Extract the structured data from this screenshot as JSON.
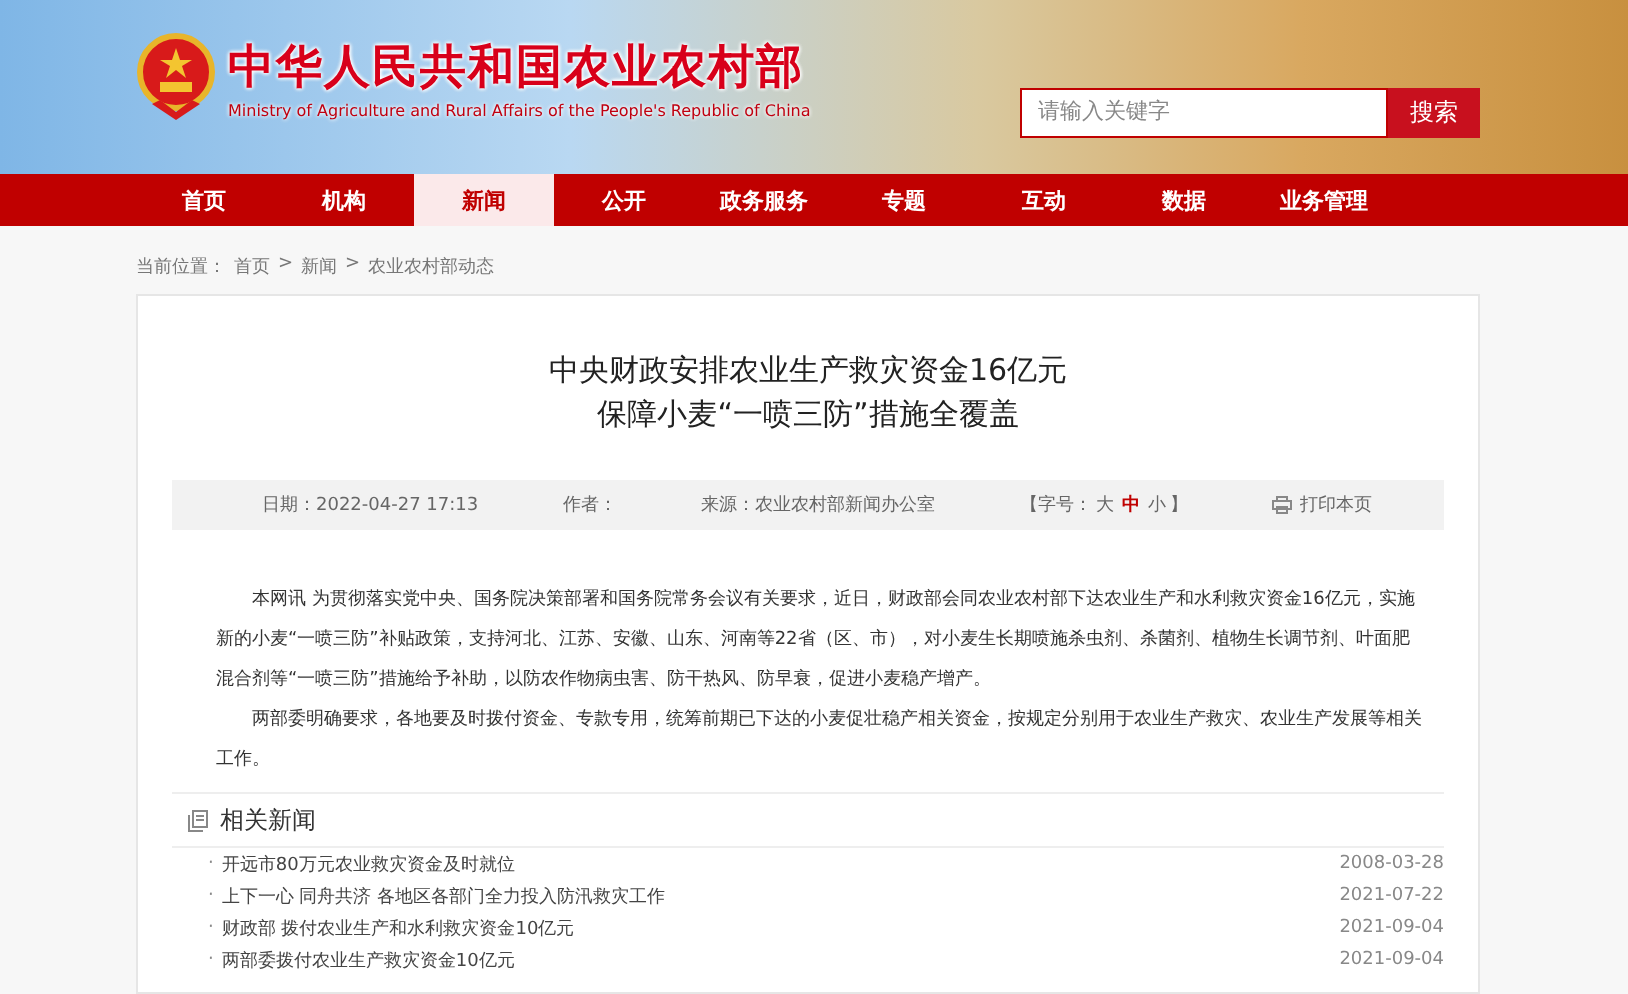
{
  "header": {
    "title": "中华人民共和国农业农村部",
    "subtitle": "Ministry of Agriculture and Rural Affairs of the People's Republic of China",
    "search": {
      "placeholder": "请输入关键字",
      "button": "搜索"
    }
  },
  "nav": [
    {
      "label": "首页",
      "selected": false
    },
    {
      "label": "机构",
      "selected": false
    },
    {
      "label": "新闻",
      "selected": true
    },
    {
      "label": "公开",
      "selected": false
    },
    {
      "label": "政务服务",
      "selected": false
    },
    {
      "label": "专题",
      "selected": false
    },
    {
      "label": "互动",
      "selected": false
    },
    {
      "label": "数据",
      "selected": false
    },
    {
      "label": "业务管理",
      "selected": false
    }
  ],
  "breadcrumb": {
    "label": "当前位置：",
    "items": [
      "首页",
      "新闻",
      "农业农村部动态"
    ],
    "separator": ">"
  },
  "article": {
    "title_lines": [
      "中央财政安排农业生产救灾资金16亿元",
      "保障小麦“一喷三防”措施全覆盖"
    ],
    "meta": {
      "date": "日期：2022-04-27 17:13",
      "author": "作者：",
      "source": "来源：农业农村部新闻办公室",
      "font_size": {
        "open": "【字号：",
        "sizes": [
          {
            "label": "大",
            "selected": false
          },
          {
            "label": "中",
            "selected": true
          },
          {
            "label": "小",
            "selected": false
          }
        ],
        "close": "】"
      },
      "print": "打印本页"
    },
    "paragraphs": [
      "本网讯 为贯彻落实党中央、国务院决策部署和国务院常务会议有关要求，近日，财政部会同农业农村部下达农业生产和水利救灾资金16亿元，实施新的小麦“一喷三防”补贴政策，支持河北、江苏、安徽、山东、河南等22省（区、市），对小麦生长期喷施杀虫剂、杀菌剂、植物生长调节剂、叶面肥混合剂等“一喷三防”措施给予补助，以防农作物病虫害、防干热风、防早衰，促进小麦稳产增产。",
      "两部委明确要求，各地要及时拨付资金、专款专用，统筹前期已下达的小麦促壮稳产相关资金，按规定分别用于农业生产救灾、农业生产发展等相关工作。"
    ]
  },
  "related": {
    "title": "相关新闻",
    "bullet": "·",
    "items": [
      {
        "title": "开远市80万元农业救灾资金及时就位",
        "date": "2008-03-28"
      },
      {
        "title": "上下一心 同舟共济 各地区各部门全力投入防汛救灾工作",
        "date": "2021-07-22"
      },
      {
        "title": "财政部 拨付农业生产和水利救灾资金10亿元",
        "date": "2021-09-04"
      },
      {
        "title": "两部委拨付农业生产救灾资金10亿元",
        "date": "2021-09-04"
      }
    ]
  }
}
